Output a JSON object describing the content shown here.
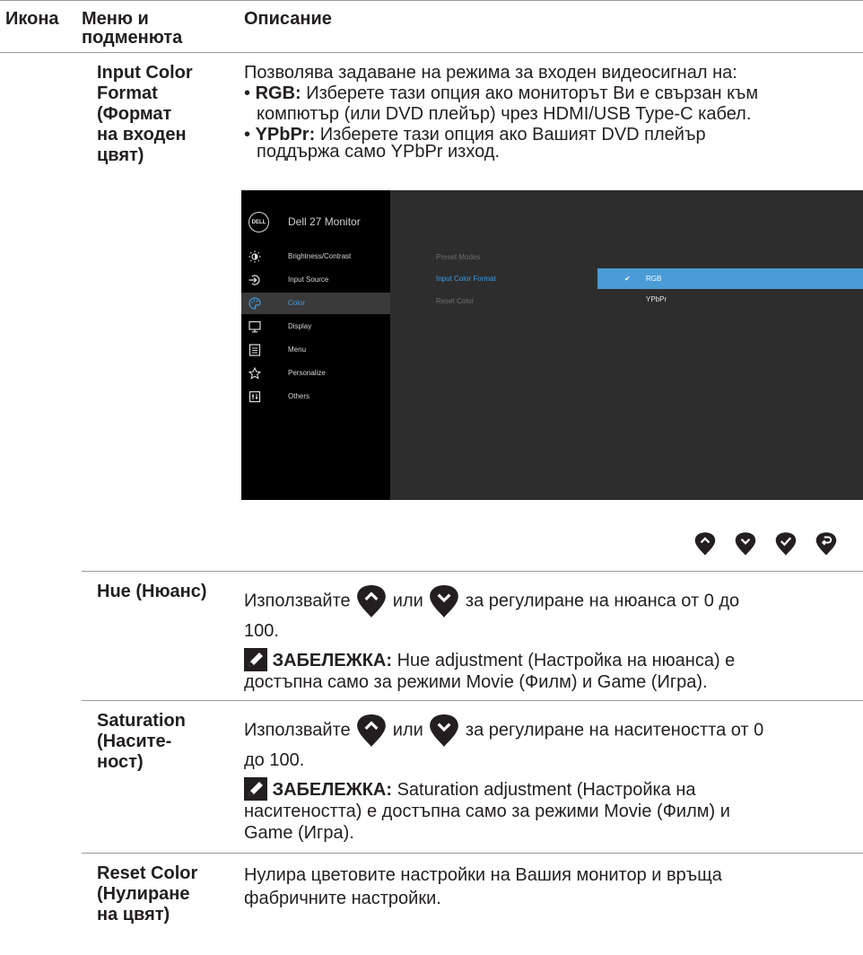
{
  "header": {
    "col_icon": "Икона",
    "col_menu_line1": "Меню и",
    "col_menu_line2": "подменюта",
    "col_desc": "Описание"
  },
  "input_color_format": {
    "title_lines": [
      "Input Color",
      "Format",
      "(Формат",
      "на входен",
      "цвят)"
    ],
    "intro": "Позволява задаване на режима за входен видеосигнал на:",
    "bullet1_label": "RGB:",
    "bullet1_text_line1": " Изберете тази опция ако мониторът Ви е свързан към",
    "bullet1_text_line2": "компютър (или DVD плейър) чрез HDMI/USB Type-C кабел.",
    "bullet2_label": "YPbPr:",
    "bullet2_text_line1": " Изберете тази опция ако Вашият DVD плейър",
    "bullet2_text_line2": "поддържа само YPbPr изход."
  },
  "osd": {
    "logo": "DELL",
    "model": "Dell 27 Monitor",
    "menu": [
      {
        "label": "Brightness/Contrast",
        "icon": "brightness-icon"
      },
      {
        "label": "Input Source",
        "icon": "input-source-icon"
      },
      {
        "label": "Color",
        "icon": "color-palette-icon",
        "selected": true
      },
      {
        "label": "Display",
        "icon": "display-icon"
      },
      {
        "label": "Menu",
        "icon": "menu-icon"
      },
      {
        "label": "Personalize",
        "icon": "star-icon"
      },
      {
        "label": "Others",
        "icon": "others-icon"
      }
    ],
    "submenu": [
      "Preset Modes",
      "Input Color Format",
      "Reset Color"
    ],
    "options": [
      "RGB",
      "YPbPr"
    ],
    "colors": {
      "bg": "#2d2d2d",
      "sidebar": "#000000",
      "accent": "#4a9bd6",
      "highlight_text": "#3d9de6"
    }
  },
  "nav_buttons": [
    "up-button-icon",
    "down-button-icon",
    "check-button-icon",
    "back-button-icon"
  ],
  "hue": {
    "title": "Hue (Нюанс)",
    "use": "Използвайте ",
    "or": " или ",
    "rest_line1": " за регулиране на нюанса от 0 до",
    "rest_line2": "100.",
    "note_label": "ЗАБЕЛЕЖКА:",
    "note_line1": " Hue adjustment (Настройка на нюанса) е",
    "note_line2": "достъпна само за режими Movie (Филм) и Game (Игра)."
  },
  "saturation": {
    "title_lines": [
      "Saturation",
      "(Насите-",
      "ност)"
    ],
    "use": "Използвайте ",
    "or": " или ",
    "rest_line1": " за регулиране на наситеността от 0",
    "rest_line2": "до 100.",
    "note_label": "ЗАБЕЛЕЖКА:",
    "note_line1": " Saturation adjustment (Настройка на",
    "note_line2": "наситеността) е достъпна само за режими Movie (Филм) и",
    "note_line3": "Game (Игра)."
  },
  "reset_color": {
    "title_lines": [
      "Reset Color",
      "(Нулиране",
      "на цвят)"
    ],
    "desc_line1": "Нулира цветовите настройки на Вашия монитор и връща",
    "desc_line2": "фабричните настройки."
  }
}
